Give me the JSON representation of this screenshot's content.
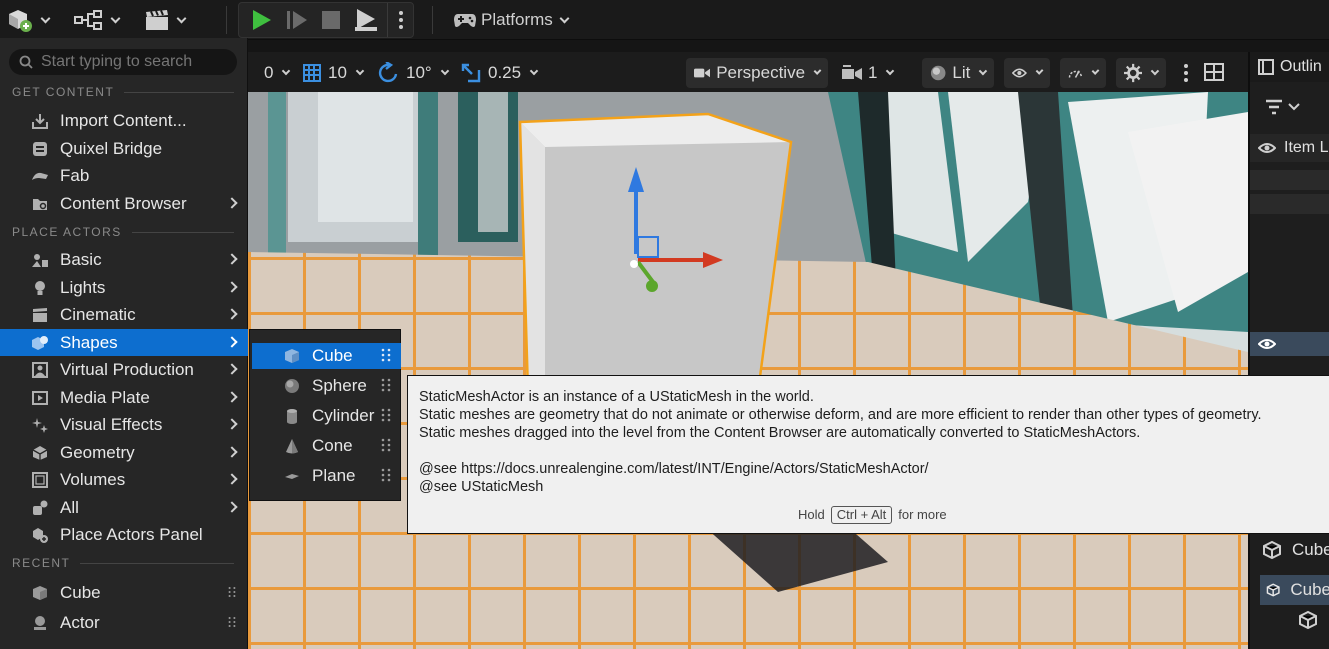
{
  "toolbar": {
    "platforms_label": "Platforms"
  },
  "viewport_toolbar": {
    "grid_snap": "0",
    "location_snap": "10",
    "rotation_snap": "10°",
    "scale_snap": "0.25",
    "view_mode": "Perspective",
    "camera_speed": "1",
    "lighting_mode": "Lit"
  },
  "outliner": {
    "title": "Outlin",
    "column_label": "Item L",
    "row_cube_1": "Cube",
    "row_cube_2": "Cube"
  },
  "menu": {
    "search_placeholder": "Start typing to search",
    "section_get_content": "GET CONTENT",
    "section_place_actors": "PLACE ACTORS",
    "section_recent": "RECENT",
    "get_content_items": [
      "Import Content...",
      "Quixel Bridge",
      "Fab",
      "Content Browser"
    ],
    "place_actor_items": [
      "Basic",
      "Lights",
      "Cinematic",
      "Shapes",
      "Virtual Production",
      "Media Plate",
      "Visual Effects",
      "Geometry",
      "Volumes",
      "All",
      "Place Actors Panel"
    ],
    "recent_items": [
      "Cube",
      "Actor"
    ]
  },
  "submenu": {
    "items": [
      "Cube",
      "Sphere",
      "Cylinder",
      "Cone",
      "Plane"
    ]
  },
  "tooltip": {
    "line1": "StaticMeshActor is an instance of a UStaticMesh in the world.",
    "line2": "Static meshes are geometry that do not animate or otherwise deform, and are more efficient to render than other types of geometry.",
    "line3": "Static meshes dragged into the level from the Content Browser are automatically converted to StaticMeshActors.",
    "line4": "@see https://docs.unrealengine.com/latest/INT/Engine/Actors/StaticMeshActor/",
    "line5": "@see UStaticMesh",
    "hint_hold": "Hold",
    "hint_key": "Ctrl + Alt",
    "hint_more": "for more"
  },
  "colors": {
    "selection": "#0d6ecf",
    "panel": "#262626",
    "toolbar": "#1a1a1a",
    "tooltip_bg": "#f0f0f0",
    "selection_outline": "#f3a21a"
  }
}
